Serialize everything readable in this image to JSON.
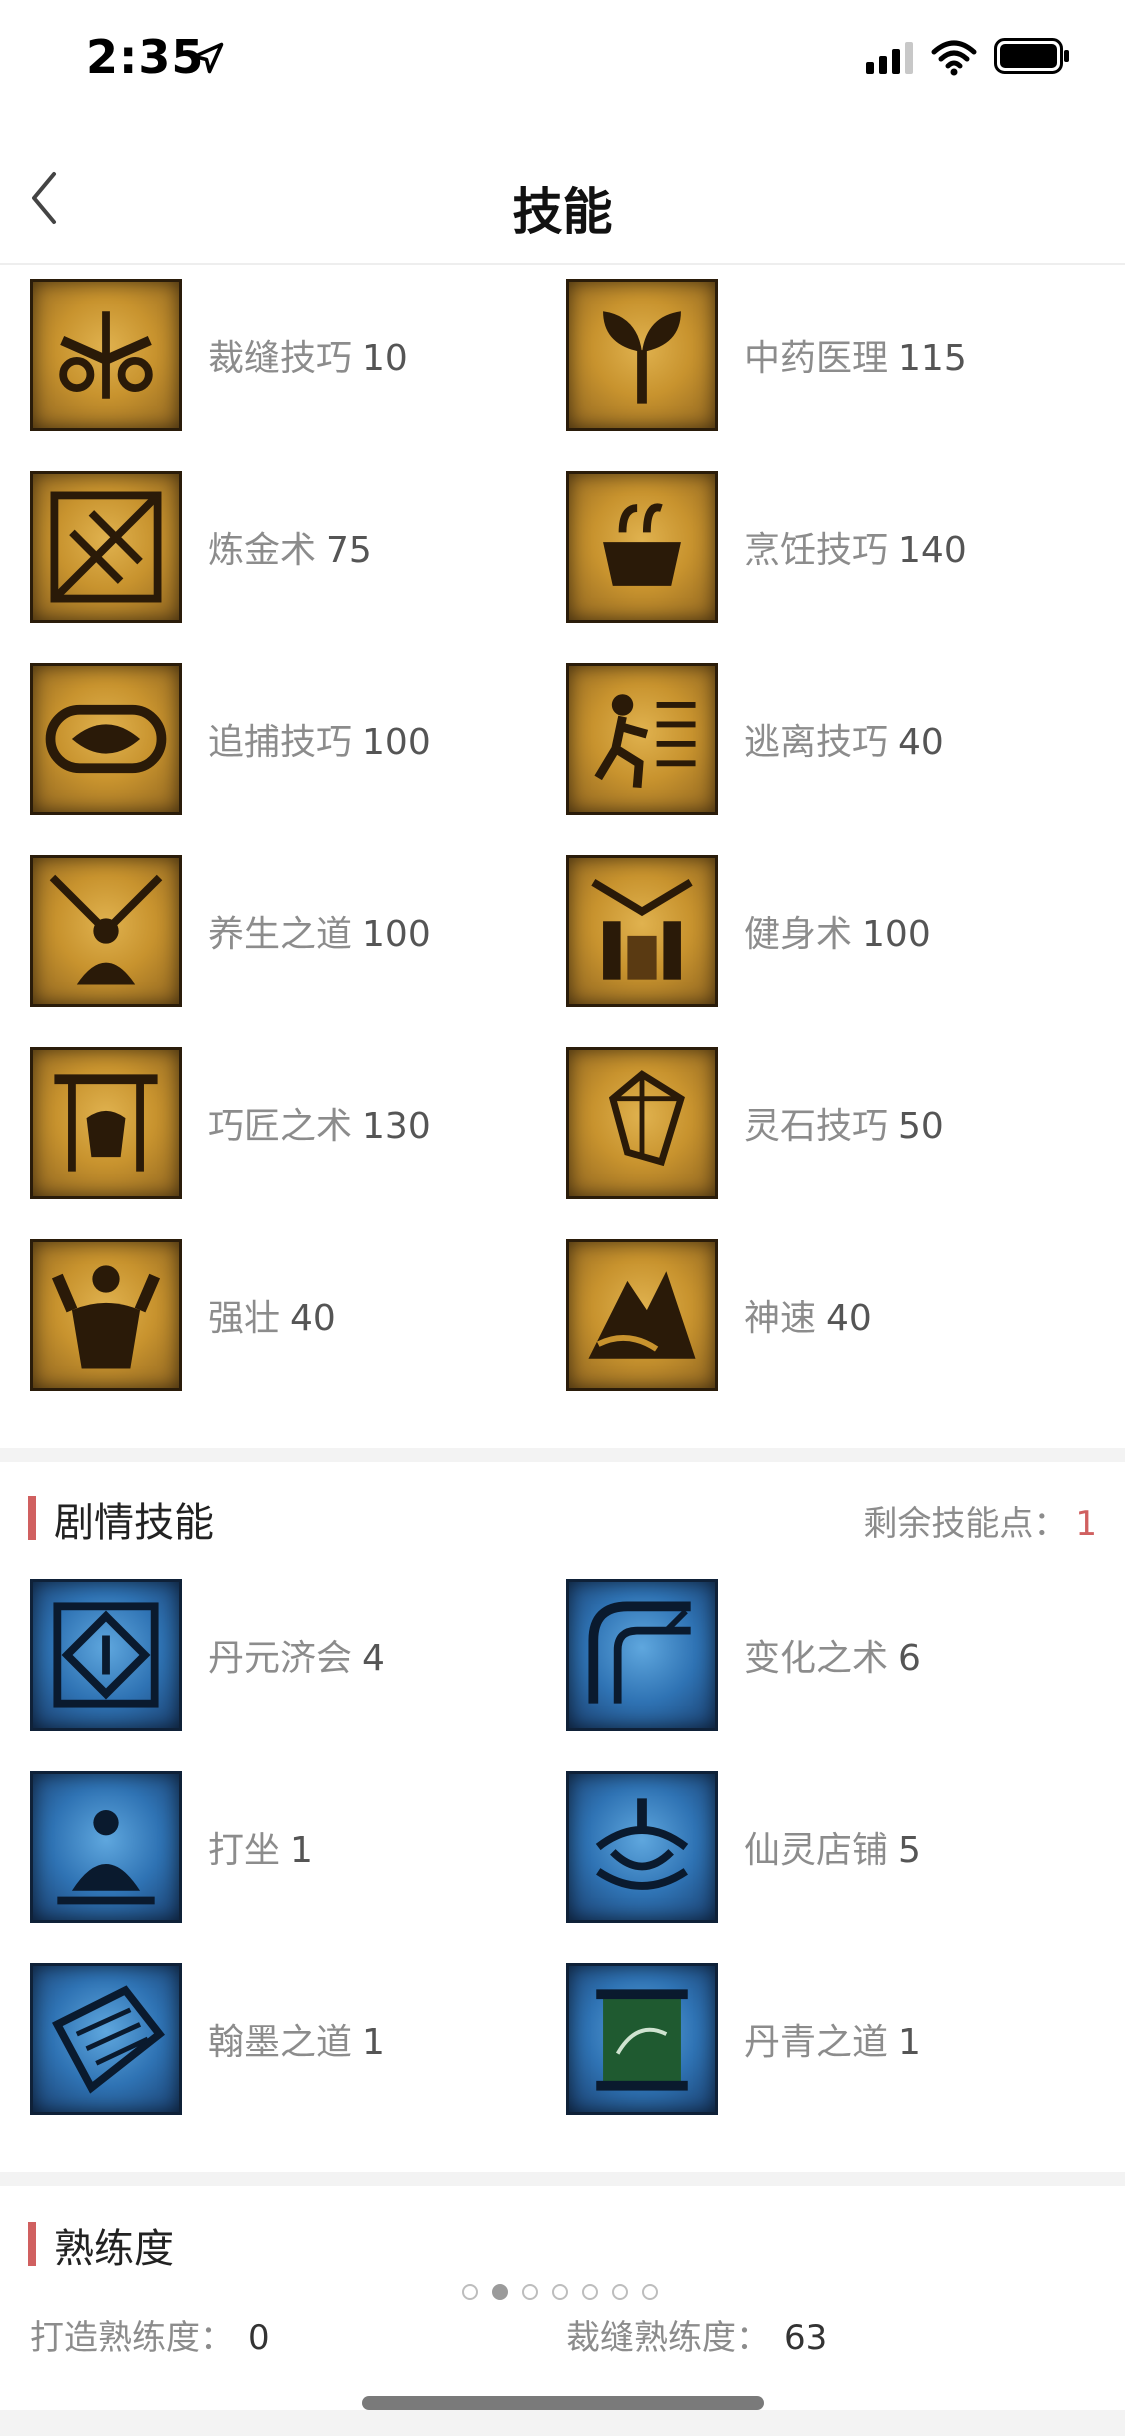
{
  "status_bar": {
    "time": "2:35"
  },
  "nav": {
    "title": "技能"
  },
  "skills": [
    {
      "name": "裁缝技巧",
      "value": "10",
      "icon": "scissors-icon"
    },
    {
      "name": "中药医理",
      "value": "115",
      "icon": "herb-sprout-icon"
    },
    {
      "name": "炼金术",
      "value": "75",
      "icon": "alchemy-icon"
    },
    {
      "name": "烹饪技巧",
      "value": "140",
      "icon": "cooking-pot-icon"
    },
    {
      "name": "追捕技巧",
      "value": "100",
      "icon": "rope-binding-icon"
    },
    {
      "name": "逃离技巧",
      "value": "40",
      "icon": "running-man-icon"
    },
    {
      "name": "养生之道",
      "value": "100",
      "icon": "meditation-icon"
    },
    {
      "name": "健身术",
      "value": "100",
      "icon": "fitness-gate-icon"
    },
    {
      "name": "巧匠之术",
      "value": "130",
      "icon": "anvil-icon"
    },
    {
      "name": "灵石技巧",
      "value": "50",
      "icon": "crystal-icon"
    },
    {
      "name": "强壮",
      "value": "40",
      "icon": "strongman-icon"
    },
    {
      "name": "神速",
      "value": "40",
      "icon": "swift-cloud-icon"
    }
  ],
  "story_section": {
    "title": "剧情技能",
    "remaining_label": "剩余技能点：",
    "remaining_value": "1",
    "skills": [
      {
        "name": "丹元济会",
        "value": "4",
        "icon": "elixir-rune-icon"
      },
      {
        "name": "变化之术",
        "value": "6",
        "icon": "transform-icon"
      },
      {
        "name": "打坐",
        "value": "1",
        "icon": "sitting-meditation-icon"
      },
      {
        "name": "仙灵店铺",
        "value": "5",
        "icon": "spirit-shop-icon"
      },
      {
        "name": "翰墨之道",
        "value": "1",
        "icon": "ink-book-icon"
      },
      {
        "name": "丹青之道",
        "value": "1",
        "icon": "painting-scroll-icon"
      }
    ]
  },
  "proficiency": {
    "title": "熟练度",
    "items": [
      {
        "label": "打造熟练度：",
        "value": "0"
      },
      {
        "label": "裁缝熟练度：",
        "value": "63"
      }
    ]
  },
  "pager": {
    "count": 7,
    "active_index": 1
  },
  "colors": {
    "accent": "#d06060",
    "gold_icon": "#c8932e",
    "blue_icon": "#2f73b4"
  }
}
